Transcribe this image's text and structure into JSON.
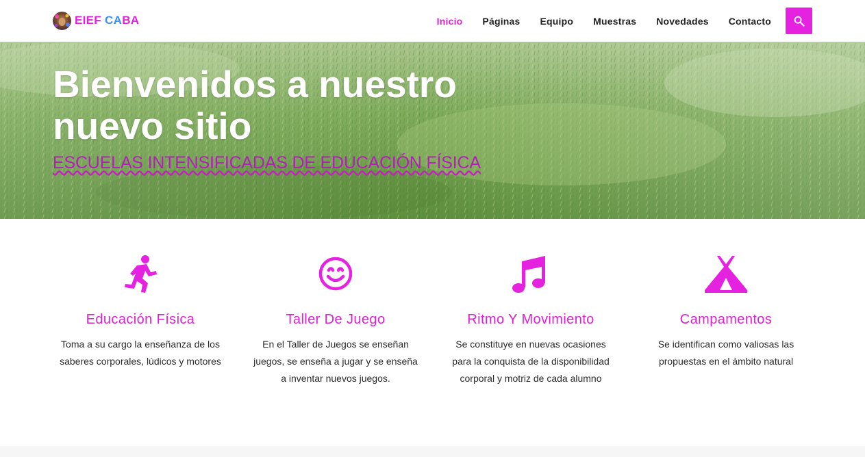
{
  "brand": {
    "name_part1": "EIEF",
    "name_part2": "CA",
    "name_part3": "BA",
    "logo_icon": "avatar-logo"
  },
  "nav": {
    "items": [
      {
        "label": "Inicio",
        "active": true
      },
      {
        "label": "Páginas",
        "active": false
      },
      {
        "label": "Equipo",
        "active": false
      },
      {
        "label": "Muestras",
        "active": false
      },
      {
        "label": "Novedades",
        "active": false
      },
      {
        "label": "Contacto",
        "active": false
      }
    ],
    "search_icon": "search-icon"
  },
  "hero": {
    "title": "Bienvenidos a nuestro nuevo sitio",
    "subtitle": "ESCUELAS INTENSIFICADAS DE EDUCACIÓN FÍSICA"
  },
  "features": [
    {
      "icon": "running-person-icon",
      "title": "Educación Física",
      "text": "Toma a su cargo la enseñanza de los saberes corporales, lúdicos y motores"
    },
    {
      "icon": "smiley-icon",
      "title": "Taller De Juego",
      "text": "En el Taller de Juegos se enseñan juegos, se enseña a jugar y se enseña a inventar nuevos juegos."
    },
    {
      "icon": "music-notes-icon",
      "title": "Ritmo Y Movimiento",
      "text": "Se constituye en nuevas ocasiones para la conquista de la disponibilidad corporal y motriz de cada alumno"
    },
    {
      "icon": "tent-icon",
      "title": "Campamentos",
      "text": "Se identifican como valiosas las propuestas en el ámbito natural"
    }
  ],
  "colors": {
    "accent": "#e622e1",
    "brand_blue": "#3d8ef8",
    "hero_subtitle": "#b41fb9"
  }
}
